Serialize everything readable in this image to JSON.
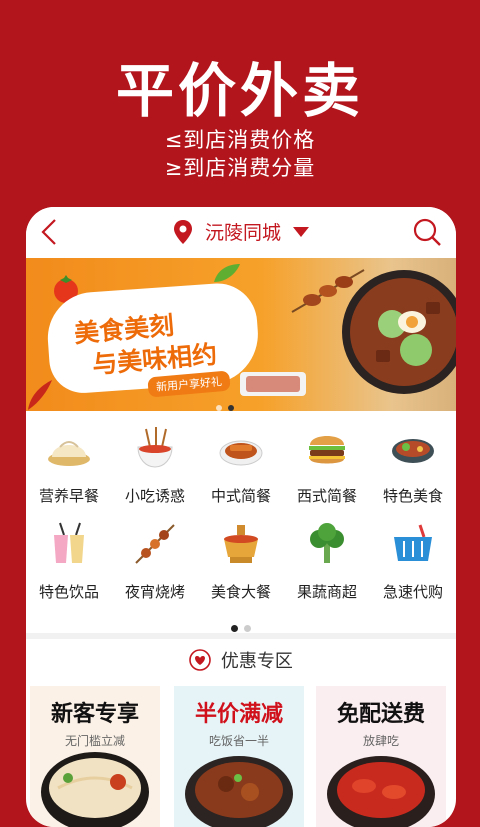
{
  "hero": {
    "title": "平价外卖",
    "line1": "≤到店消费价格",
    "line2": "≥到店消费分量"
  },
  "topbar": {
    "city": "沅陵同城",
    "icons": [
      "back-icon",
      "location-pin-icon",
      "caret-down-icon",
      "search-icon"
    ]
  },
  "banner": {
    "line1": "美食美刻",
    "line2": "与美味相约",
    "tag": "新用户享好礼",
    "dots": 2,
    "active_dot": 2
  },
  "categories": [
    {
      "label": "营养早餐",
      "icon": "dumpling-icon"
    },
    {
      "label": "小吃诱惑",
      "icon": "snack-bowl-icon"
    },
    {
      "label": "中式简餐",
      "icon": "chinese-dish-icon"
    },
    {
      "label": "西式简餐",
      "icon": "burger-icon"
    },
    {
      "label": "特色美食",
      "icon": "special-dish-icon"
    },
    {
      "label": "特色饮品",
      "icon": "drinks-icon"
    },
    {
      "label": "夜宵烧烤",
      "icon": "skewer-icon"
    },
    {
      "label": "美食大餐",
      "icon": "hotpot-icon"
    },
    {
      "label": "果蔬商超",
      "icon": "broccoli-icon"
    },
    {
      "label": "急速代购",
      "icon": "shopping-basket-icon"
    }
  ],
  "pager": {
    "pages": 2,
    "active": 1
  },
  "deals_section": {
    "title": "优惠专区",
    "icon": "heart-icon",
    "cards": [
      {
        "title": "新客专享",
        "subtitle": "无门槛立减",
        "title_color": "#111111",
        "bg": "#fbf1e6"
      },
      {
        "title": "半价满减",
        "subtitle": "吃饭省一半",
        "title_color": "#d0101b",
        "bg": "#e6f4f7"
      },
      {
        "title": "免配送费",
        "subtitle": "放肆吃",
        "title_color": "#111111",
        "bg": "#fbeef0"
      }
    ]
  },
  "colors": {
    "brand": "#b3151d",
    "accent": "#c31820"
  }
}
